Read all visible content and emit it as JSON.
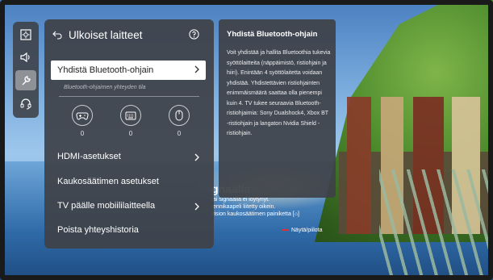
{
  "background": {
    "message_title": "gnaalia",
    "message_lines": [
      "tai signaalia ei löytynyt.",
      "tennikaapeli liitetty oikein.",
      "vision kaukosäätimen painiketta [⌂]"
    ],
    "hint": "Näytä/piilota"
  },
  "nav_rail": {
    "items": [
      {
        "name": "picture",
        "icon": "picture-icon"
      },
      {
        "name": "sound",
        "icon": "speaker-icon"
      },
      {
        "name": "general",
        "icon": "wrench-icon",
        "active": true
      },
      {
        "name": "support",
        "icon": "headset-icon"
      }
    ]
  },
  "panel": {
    "title": "Ulkoiset laitteet",
    "bluetooth_item": "Yhdistä Bluetooth-ohjain",
    "bluetooth_sub": "Bluetooth-ohjaimen yhteyden tila",
    "devices": [
      {
        "icon": "gamepad-icon",
        "count": "0"
      },
      {
        "icon": "keyboard-icon",
        "count": "0"
      },
      {
        "icon": "mouse-icon",
        "count": "0"
      }
    ],
    "menu": [
      {
        "label": "HDMI-asetukset",
        "chevron": true
      },
      {
        "label": "Kaukosäätimen asetukset",
        "chevron": false
      },
      {
        "label": "TV päälle mobiililaitteella",
        "chevron": true
      },
      {
        "label": "Poista yhteyshistoria",
        "chevron": false
      }
    ]
  },
  "info": {
    "title": "Yhdistä Bluetooth-ohjain",
    "body": "Voit yhdistää ja hallita Bluetoothia tukevia syöttölaitteita (näppäimistö, ristiohjain ja hiiri). Enintään 4 syöttölaitetta voidaan yhdistää. Yhdistettävien ristiohjainten enimmäismäärä saattaa olla pienempi kuin 4. TV tukee seuraavia Bluetooth-ristiohjaimia: Sony Dualshock4, Xbox BT -ristiohjain ja langaton Nvidia Shield -ristiohjain."
  },
  "colors": {
    "panel_bg": "#3e4248",
    "active_rail": "#8e9196",
    "highlight": "#ffffff",
    "hint_red": "#e03030"
  }
}
